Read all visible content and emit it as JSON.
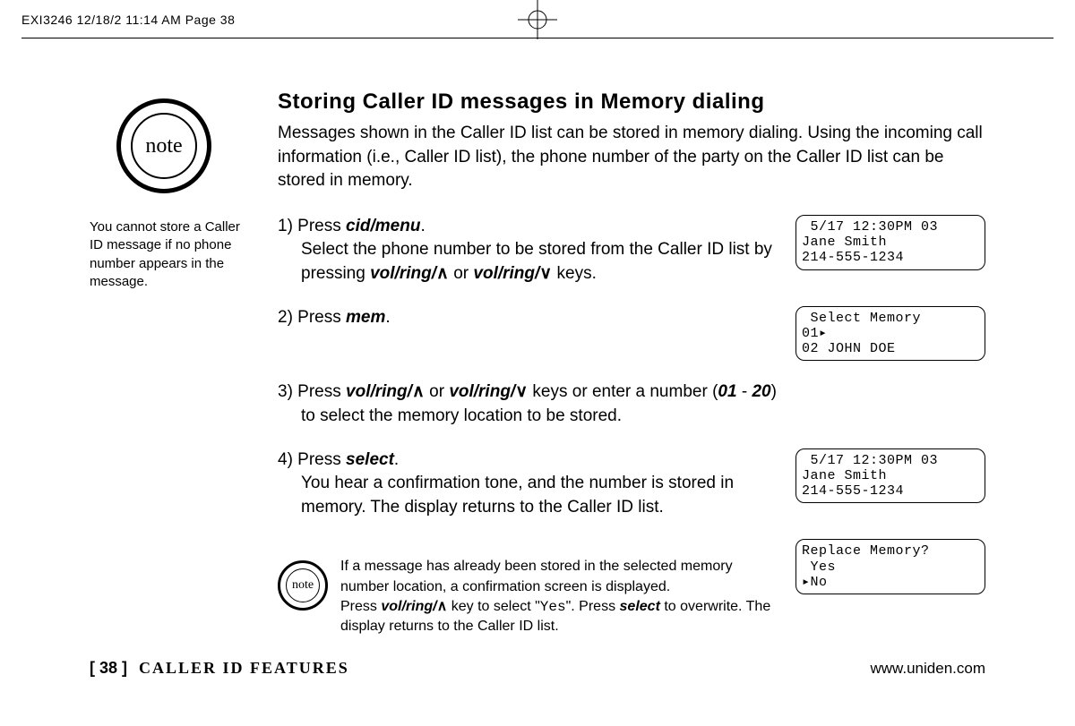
{
  "topbar": "EXI3246  12/18/2 11:14 AM  Page 38",
  "note_label": "note",
  "sidebar_note": "You cannot store a Caller ID message if no phone number appears in the message.",
  "title": "Storing Caller ID messages in Memory dialing",
  "intro": "Messages shown in the Caller ID list can be stored in memory dialing. Using the incoming call information (i.e., Caller ID list), the phone number of the party on the Caller ID list can be stored in memory.",
  "steps": {
    "s1_a": "1) Press ",
    "s1_b": "cid/menu",
    "s1_c": ".",
    "s1_d": "Select the phone number to be stored from the Caller ID list by pressing ",
    "s1_e": "vol/ring/",
    "s1_f": " or ",
    "s1_g": "vol/ring/",
    "s1_h": " keys.",
    "s2_a": "2) Press ",
    "s2_b": "mem",
    "s2_c": ".",
    "s3_a": "3) Press ",
    "s3_b": "vol/ring/",
    "s3_c": " or ",
    "s3_d": "vol/ring/",
    "s3_e": " keys or enter a number (",
    "s3_f": "01",
    "s3_g": " - ",
    "s3_h": "20",
    "s3_i": ") to select the memory location to be stored.",
    "s4_a": "4) Press ",
    "s4_b": "select",
    "s4_c": ".",
    "s4_d": "You hear a confirmation tone, and the number is stored in memory. The display returns to the Caller ID list."
  },
  "lcd": {
    "d1": " 5/17 12:30PM 03\nJane Smith\n214-555-1234",
    "d2": " Select Memory\n01▸\n02 JOHN DOE",
    "d3": " 5/17 12:30PM 03\nJane Smith\n214-555-1234",
    "d4": "Replace Memory?\n Yes\n▸No"
  },
  "inline_note": {
    "a": "If a message has already been stored in the selected memory number location, a confirmation screen is displayed.",
    "b1": "Press ",
    "b2": "vol/ring/",
    "b3": " key to select \"",
    "b4": "Yes",
    "b5": "\". Press ",
    "b6": "select",
    "b7": " to overwrite. The display returns to the Caller ID list."
  },
  "footer": {
    "page": "[ 38 ]",
    "section": "CALLER ID FEATURES",
    "url": "www.uniden.com"
  },
  "arrows": {
    "up": "∧",
    "down": "∨"
  }
}
